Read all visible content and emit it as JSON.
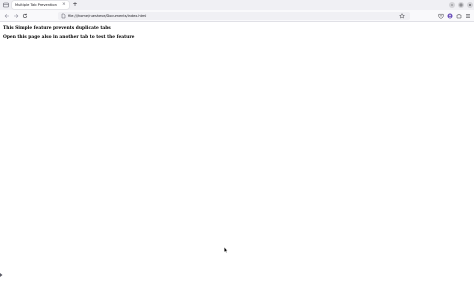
{
  "browser": {
    "tab": {
      "title": "Multiple Tab Prevention",
      "close_glyph": "×"
    },
    "new_tab_glyph": "+",
    "url": "file:///home/ruesheve/Documents/index.html",
    "icons": {
      "tab_list": "tab-list-icon",
      "back": "back-arrow-icon",
      "forward": "forward-arrow-icon",
      "reload": "reload-icon",
      "page_info": "page-info-icon",
      "bookmark": "bookmark-star-icon",
      "pocket": "pocket-icon",
      "account": "account-icon",
      "extensions": "extensions-icon",
      "menu": "menu-icon",
      "minimize": "minimize-icon",
      "maximize": "maximize-icon",
      "close": "close-window-icon"
    }
  },
  "page": {
    "paragraphs": [
      "This Simple feature prevents duplicate tabs",
      "Open this page also in another tab to test the feature"
    ]
  }
}
